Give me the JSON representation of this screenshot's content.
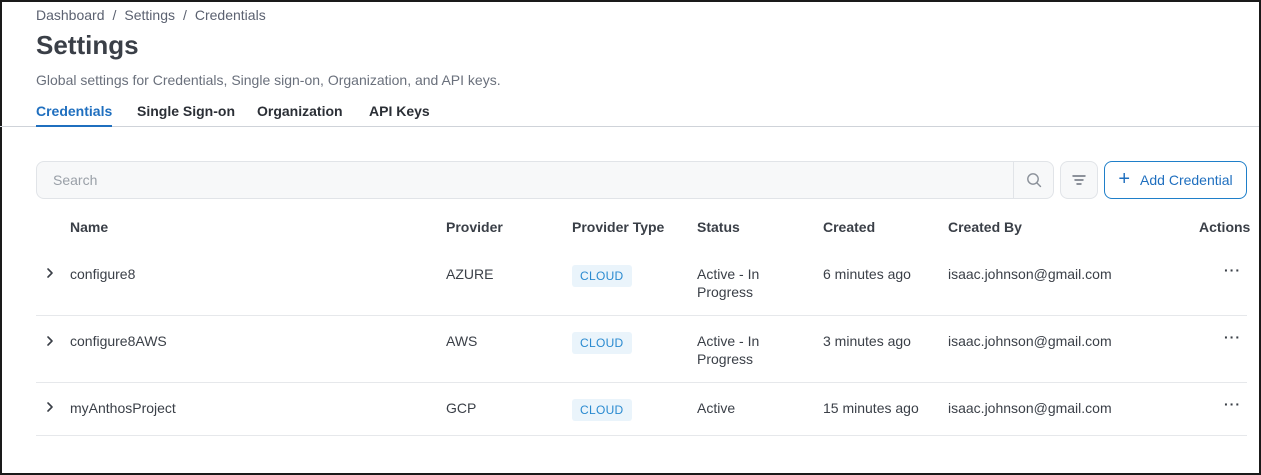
{
  "breadcrumb": {
    "items": [
      "Dashboard",
      "Settings",
      "Credentials"
    ],
    "separator": "/"
  },
  "page": {
    "title": "Settings",
    "description": "Global settings for Credentials, Single sign-on, Organization, and API keys."
  },
  "tabs": [
    {
      "label": "Credentials",
      "active": true
    },
    {
      "label": "Single Sign-on",
      "active": false
    },
    {
      "label": "Organization",
      "active": false
    },
    {
      "label": "API Keys",
      "active": false
    }
  ],
  "toolbar": {
    "search_placeholder": "Search",
    "search_icon": "search-icon",
    "filter_icon": "filter-icon",
    "add_label": "Add Credential"
  },
  "table": {
    "columns": [
      "Name",
      "Provider",
      "Provider Type",
      "Status",
      "Created",
      "Created By",
      "Actions"
    ],
    "rows": [
      {
        "name": "configure8",
        "provider": "AZURE",
        "provider_type": "CLOUD",
        "status_line1": "Active - In",
        "status_line2": "Progress",
        "created": "6 minutes ago",
        "created_by": "isaac.johnson@gmail.com",
        "actions": "···"
      },
      {
        "name": "configure8AWS",
        "provider": "AWS",
        "provider_type": "CLOUD",
        "status_line1": "Active - In",
        "status_line2": "Progress",
        "created": "3 minutes ago",
        "created_by": "isaac.johnson@gmail.com",
        "actions": "···"
      },
      {
        "name": "myAnthosProject",
        "provider": "GCP",
        "provider_type": "CLOUD",
        "status_line1": "Active",
        "status_line2": "",
        "created": "15 minutes ago",
        "created_by": "isaac.johnson@gmail.com",
        "actions": "···"
      }
    ]
  },
  "colors": {
    "accent": "#1f6fbf",
    "badge_bg": "#eaf4fb",
    "badge_text": "#2a8ad0"
  }
}
